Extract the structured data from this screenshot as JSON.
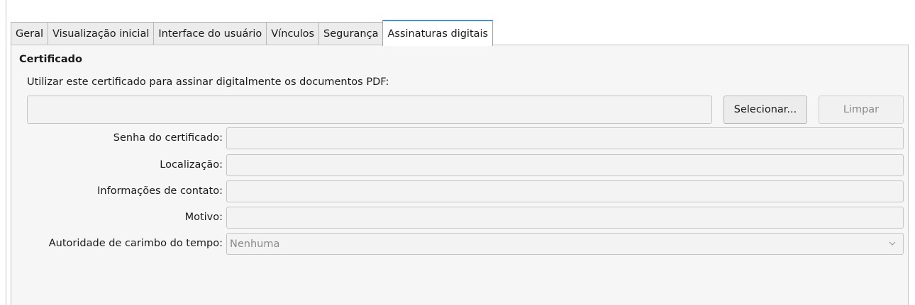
{
  "tabs": [
    {
      "label": "Geral",
      "active": false
    },
    {
      "label": "Visualização inicial",
      "active": false
    },
    {
      "label": "Interface do usuário",
      "active": false
    },
    {
      "label": "Vínculos",
      "active": false
    },
    {
      "label": "Segurança",
      "active": false
    },
    {
      "label": "Assinaturas digitais",
      "active": true
    }
  ],
  "certificate": {
    "section_title": "Certificado",
    "use_label": "Utilizar este certificado para assinar digitalmente os documentos PDF:",
    "path_value": "",
    "select_button": "Selecionar...",
    "clear_button": "Limpar"
  },
  "fields": {
    "password_label": "Senha do certificado:",
    "password_value": "",
    "location_label": "Localização:",
    "location_value": "",
    "contact_label": "Informações de contato:",
    "contact_value": "",
    "reason_label": "Motivo:",
    "reason_value": "",
    "tsa_label": "Autoridade de carimbo do tempo:",
    "tsa_value": "Nenhuma"
  },
  "icons": {
    "dropdown": "chevron-down-icon"
  },
  "colors": {
    "active_tab_accent": "#4a90d9",
    "panel_bg": "#f6f6f6",
    "disabled_text": "#8a8a8a"
  }
}
